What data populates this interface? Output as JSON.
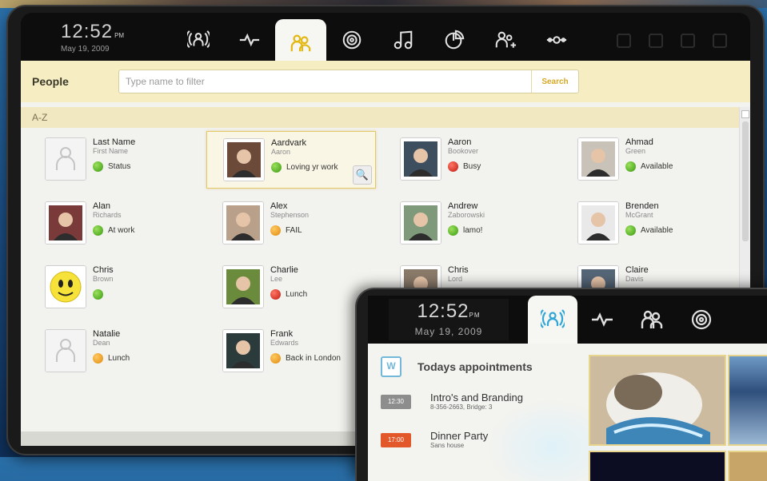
{
  "main": {
    "clock": {
      "time": "12:52",
      "ampm": "PM",
      "date": "May 19, 2009"
    },
    "nav_tabs": [
      {
        "icon": "broadcast-people-icon"
      },
      {
        "icon": "pulse-icon"
      },
      {
        "icon": "people-icon",
        "active": true
      },
      {
        "icon": "target-icon"
      },
      {
        "icon": "music-icon"
      },
      {
        "icon": "pie-chart-icon"
      },
      {
        "icon": "add-person-icon"
      },
      {
        "icon": "connector-icon"
      }
    ],
    "section_title": "People",
    "search": {
      "placeholder": "Type name to filter",
      "button": "Search"
    },
    "alpha_header": "A-Z",
    "contacts": [
      {
        "first": "Last Name",
        "last": "First Name",
        "status": "Status",
        "color": "green",
        "avatar": "placeholder"
      },
      {
        "first": "Aardvark",
        "last": "Aaron",
        "status": "Loving yr work",
        "color": "green",
        "avatar": "photo",
        "selected": true
      },
      {
        "first": "Aaron",
        "last": "Bookover",
        "status": "Busy",
        "color": "red",
        "avatar": "photo"
      },
      {
        "first": "Ahmad",
        "last": "Green",
        "status": "Available",
        "color": "green",
        "avatar": "photo"
      },
      {
        "first": "Alan",
        "last": "Richards",
        "status": "At work",
        "color": "green",
        "avatar": "photo"
      },
      {
        "first": "Alex",
        "last": "Stephenson",
        "status": "FAIL",
        "color": "orange",
        "avatar": "photo"
      },
      {
        "first": "Andrew",
        "last": "Zaborowski",
        "status": "lamo!",
        "color": "green",
        "avatar": "photo"
      },
      {
        "first": "Brenden",
        "last": "McGrant",
        "status": "Available",
        "color": "green",
        "avatar": "photo"
      },
      {
        "first": "Chris",
        "last": "Brown",
        "status": "",
        "color": "green",
        "avatar": "smiley"
      },
      {
        "first": "Charlie",
        "last": "Lee",
        "status": "Lunch",
        "color": "red",
        "avatar": "photo"
      },
      {
        "first": "Chris",
        "last": "Lord",
        "status": "",
        "color": "",
        "avatar": "photo"
      },
      {
        "first": "Claire",
        "last": "Davis",
        "status": "",
        "color": "",
        "avatar": "photo"
      },
      {
        "first": "Natalie",
        "last": "Dean",
        "status": "Lunch",
        "color": "orange",
        "avatar": "placeholder"
      },
      {
        "first": "Frank",
        "last": "Edwards",
        "status": "Back in London",
        "color": "orange",
        "avatar": "photo"
      }
    ]
  },
  "overlay": {
    "clock": {
      "time": "12:52",
      "ampm": "PM",
      "date": "May 19, 2009"
    },
    "nav_tabs": [
      {
        "icon": "broadcast-people-icon",
        "active": true
      },
      {
        "icon": "pulse-icon"
      },
      {
        "icon": "people-icon"
      },
      {
        "icon": "target-icon"
      }
    ],
    "appointments_title": "Todays appointments",
    "appointments": [
      {
        "time": "12:30",
        "title": "Intro's and Branding",
        "detail": "8-356-2663, Bridge: 3",
        "color": "#8d8d8d"
      },
      {
        "time": "17:00",
        "title": "Dinner Party",
        "detail": "Sans house",
        "color": "#e3582b"
      }
    ]
  }
}
